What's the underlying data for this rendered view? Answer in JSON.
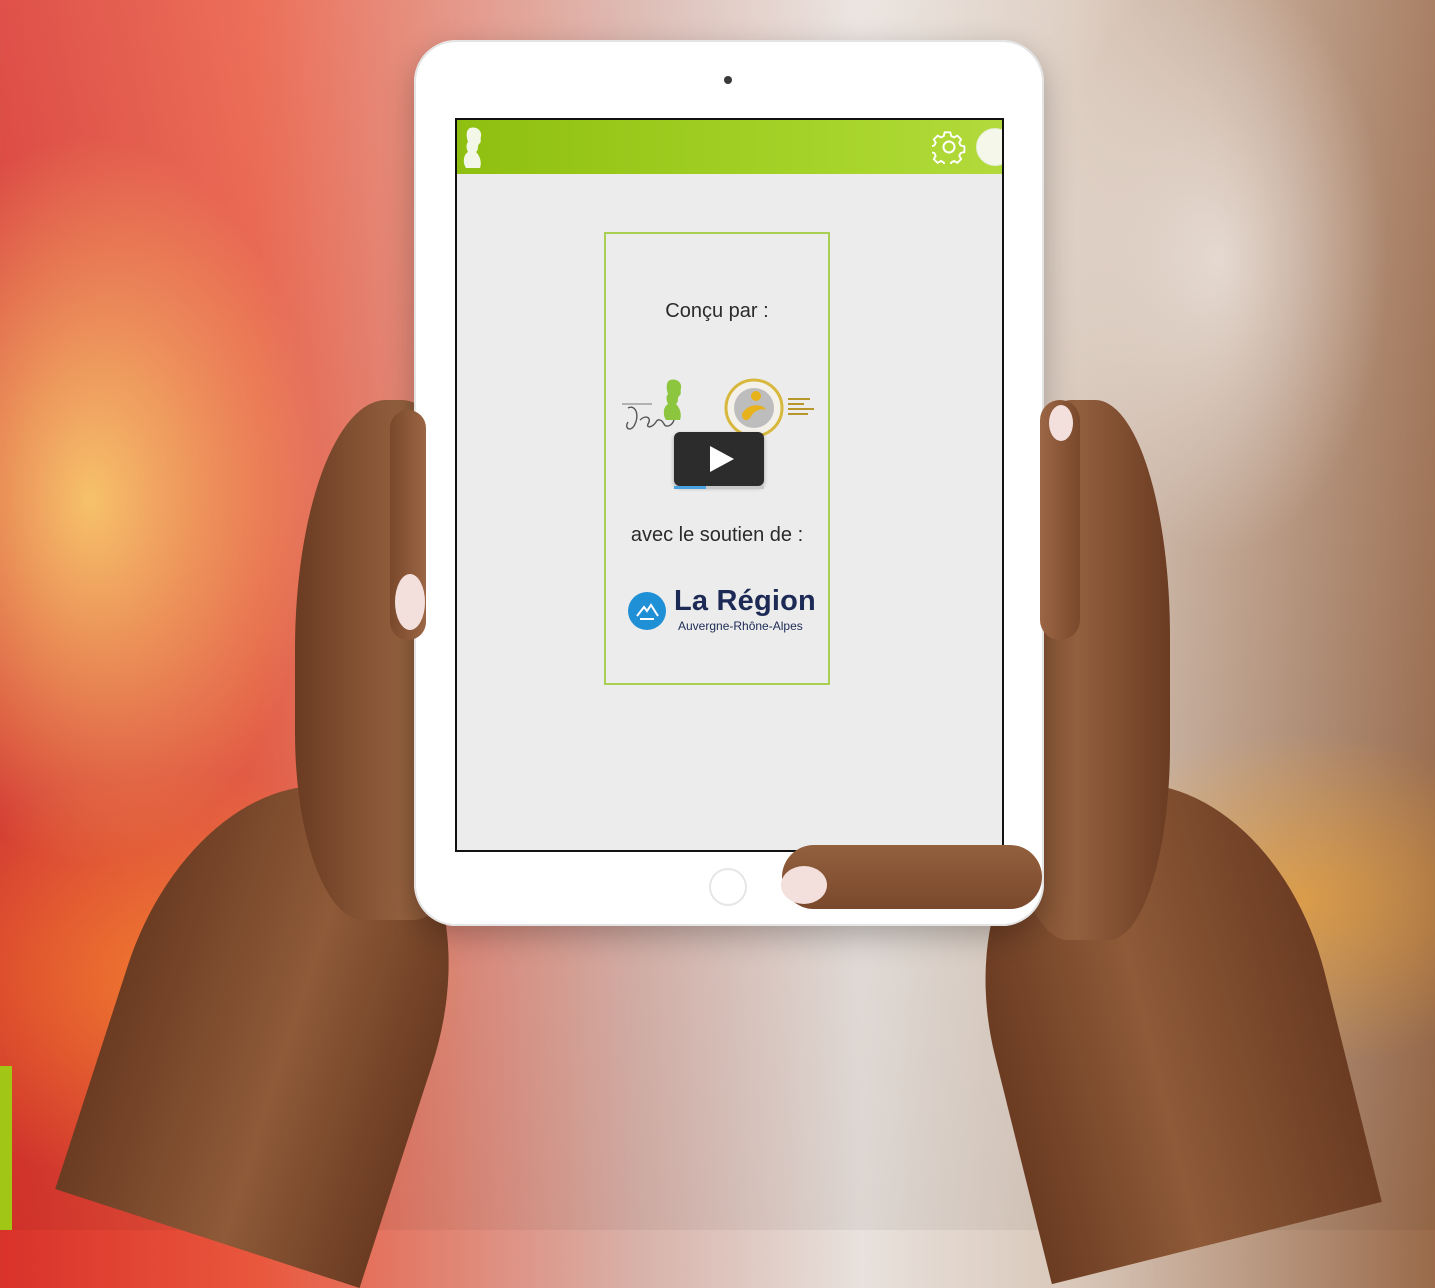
{
  "credits_card": {
    "designed_by_label": "Conçu par :",
    "support_label": "avec le soutien de :",
    "video_progress_fraction": 0.35
  },
  "region_logo": {
    "title": "La Région",
    "subtitle": "Auvergne-Rhône-Alpes",
    "color": "#1f8fd6"
  },
  "header": {
    "icons": [
      "voltaire-silhouette-icon",
      "gear-icon",
      "profile-icon"
    ],
    "color": "#9ac41a"
  },
  "colors": {
    "accent_green": "#a1c616",
    "card_border": "#a8cf52",
    "screen_background": "#ececec"
  }
}
